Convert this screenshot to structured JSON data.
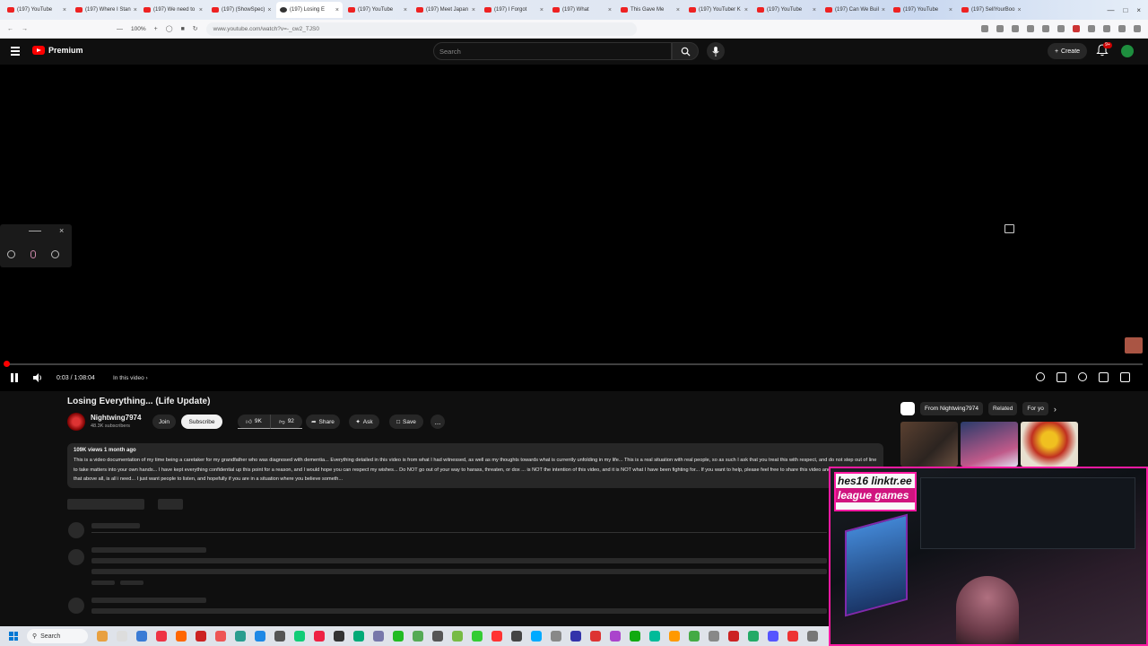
{
  "browser": {
    "tabs": [
      {
        "label": "(197) YouTube",
        "active": false
      },
      {
        "label": "(197) Where I Stan",
        "active": false
      },
      {
        "label": "(197) We need to",
        "active": false
      },
      {
        "label": "(197) (ShowSpec)",
        "active": false
      },
      {
        "label": "(197) Losing E",
        "active": true
      },
      {
        "label": "(197) YouTube",
        "active": false
      },
      {
        "label": "(197) Meet Japan",
        "active": false
      },
      {
        "label": "(197) I Forgot",
        "active": false
      },
      {
        "label": "(197) What",
        "active": false
      },
      {
        "label": "This Gave Me",
        "active": false
      },
      {
        "label": "(197) YouTuber K",
        "active": false
      },
      {
        "label": "(197) YouTube",
        "active": false
      },
      {
        "label": "(197) Can We Buil",
        "active": false
      },
      {
        "label": "(197) YouTube",
        "active": false
      },
      {
        "label": "(197) SellYourBoo",
        "active": false
      }
    ],
    "zoom": "100%",
    "url": "www.youtube.com/watch?v=-_cw2_TJS0"
  },
  "header": {
    "logo_text": "Premium",
    "search_placeholder": "Search",
    "create_label": "Create",
    "notification_count": "9+"
  },
  "player": {
    "time": "0:03 / 1:08:04",
    "in_video_label": "In this video",
    "progress_fraction": 0.0007
  },
  "video": {
    "title": "Losing Everything... (Life Update)",
    "channel_name": "Nightwing7974",
    "subscribers": "48.3K subscribers",
    "join_label": "Join",
    "subscribe_label": "Subscribe",
    "likes": "9K",
    "dislikes": "92",
    "share_label": "Share",
    "ask_label": "Ask",
    "save_label": "Save",
    "more_label": "...",
    "views_meta": "109K views  1 month ago",
    "description": "This is a video documentation of my time being a caretaker for my grandfather who was diagnosed with dementia... Everything detailed in this video is from what I had witnessed, as well as my thoughts towards what is currently unfolding in my life... This is a real situation with real people, so as such I ask that you treat this with respect, and do not step out of line to take matters into your own hands... I have kept everything confidential up this point for a reason, and I would hope you can respect my wishes... Do NOT go out of your way to harass, threaten, or dox ... is NOT the intention of this video, and it is NOT what I have been fighting for... If you want to help, please feel free to share this video and share my story... that above all, is all i need... I just want people to listen, and hopefully if you are in a situation where you believe someth..."
  },
  "sidebar": {
    "chips": [
      "From Nightwing7974",
      "Related",
      "For yo"
    ]
  },
  "webcam": {
    "overlay_line1": "hes16 linktr.ee",
    "overlay_line2": "league games"
  },
  "taskbar": {
    "search_label": "Search"
  },
  "colors": {
    "accent": "#ff0000",
    "cam_border": "#ff1aa3",
    "background": "#0f0f0f"
  }
}
